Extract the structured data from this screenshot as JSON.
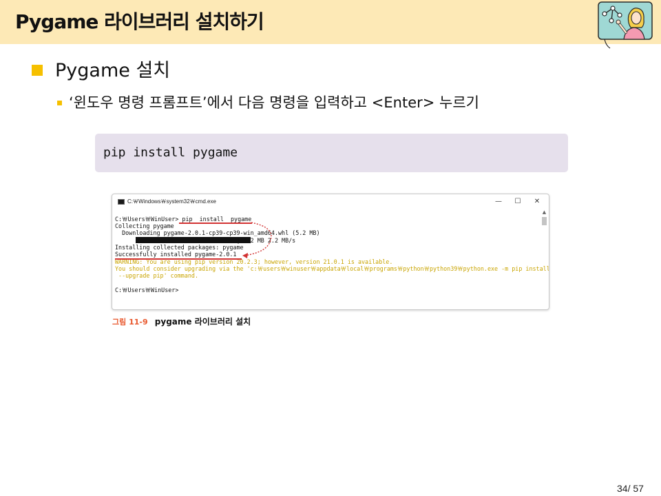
{
  "header": {
    "title": "Pygame 라이브러리 설치하기"
  },
  "content": {
    "bullet1": "Pygame 설치",
    "bullet2": "‘윈도우 명령 프롬프트’에서 다음 명령을 입력하고 <Enter> 누르기",
    "code": "pip install pygame"
  },
  "cmd_window": {
    "title": "C:￦Windows￦system32￦cmd.exe",
    "buttons": {
      "minimize": "—",
      "maximize": "☐",
      "close": "✕"
    },
    "lines": [
      "C:￦Users￦WinUser> pip  install  pygame",
      "Collecting pygame",
      "  Downloading pygame-2.0.1-cp39-cp39-win_amd64.whl (5.2 MB)",
      "                                   | 5.2 MB 2.2 MB/s",
      "Installing collected packages: pygame",
      "Successfully installed pygame-2.0.1",
      "WARNING: You are using pip version 20.2.3; however, version 21.0.1 is available.",
      "You should consider upgrading via the 'c:￦users￦winuser￦appdata￦local￦programs￦python￦python39￦python.exe -m pip install",
      " --upgrade pip' command.",
      "C:￦Users￦WinUser>"
    ],
    "warn_color": "#c9a400",
    "annotation_color": "#d23232"
  },
  "caption": {
    "number": "그림 11-9",
    "text": "pygame 라이브러리 설치"
  },
  "page": {
    "number": "34/ 57"
  },
  "colors": {
    "header_bg": "#fde9b6",
    "bullet": "#f6c000",
    "code_bg": "#e6e0ec"
  },
  "icons": {
    "mascot": "teacher-pointing-icon"
  }
}
